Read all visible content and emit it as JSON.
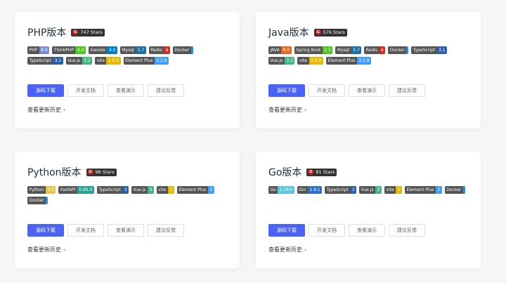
{
  "cards": [
    {
      "title": "PHP版本",
      "stars": "747 Stars",
      "badges": [
        {
          "k": "PHP",
          "v": "8.0",
          "color": "#7b8ed0"
        },
        {
          "k": "ThinkPHP",
          "v": "6.0",
          "color": "#4cc61e"
        },
        {
          "k": "Swoole",
          "v": "4.0",
          "color": "#007ec6"
        },
        {
          "k": "Mysql",
          "v": "5.7",
          "color": "#1c6ea4"
        },
        {
          "k": "Redis",
          "v": "6",
          "color": "#d9281e"
        },
        {
          "k": "Docker",
          "v": "",
          "color": "#1d8ff0"
        },
        {
          "k": "TypeScript",
          "v": "3.1",
          "color": "#2b5fa8"
        },
        {
          "k": "Vue.js",
          "v": "3.2",
          "color": "#42b883"
        },
        {
          "k": "vite",
          "v": "2.0.0",
          "color": "#e6b800"
        },
        {
          "k": "Element Plus",
          "v": "2.2.8",
          "color": "#409eff"
        }
      ],
      "buttons": [
        "源码下载",
        "开发文档",
        "查看演示",
        "建议反馈"
      ],
      "history": "查看更新历史"
    },
    {
      "title": "Java版本",
      "stars": "576 Stars",
      "badges": [
        {
          "k": "JAVA",
          "v": "8.0",
          "color": "#e56a1f"
        },
        {
          "k": "Spring Boot",
          "v": "2.5",
          "color": "#4cc61e"
        },
        {
          "k": "Mysql",
          "v": "5.7",
          "color": "#1c6ea4"
        },
        {
          "k": "Redis",
          "v": "6",
          "color": "#d9281e"
        },
        {
          "k": "Docker",
          "v": "",
          "color": "#1d8ff0"
        },
        {
          "k": "TypeScript",
          "v": "3.1",
          "color": "#2b5fa8"
        },
        {
          "k": "Vue.js",
          "v": "3.2",
          "color": "#42b883"
        },
        {
          "k": "vite",
          "v": "2.0.0",
          "color": "#e6b800"
        },
        {
          "k": "Element Plus",
          "v": "2.2.8",
          "color": "#409eff"
        }
      ],
      "buttons": [
        "源码下载",
        "开发文档",
        "查看演示",
        "建议反馈"
      ],
      "history": "查看更新历史"
    },
    {
      "title": "Python版本",
      "stars": "98 Stars",
      "badges": [
        {
          "k": "Python",
          "v": "3.5",
          "color": "#e6c34a"
        },
        {
          "k": "FastAPI",
          "v": "0.85.0",
          "color": "#2aa198"
        },
        {
          "k": "TypeScript",
          "v": "3",
          "color": "#2b5fa8"
        },
        {
          "k": "Vue.js",
          "v": "3",
          "color": "#42b883"
        },
        {
          "k": "vite",
          "v": "2",
          "color": "#e6b800"
        },
        {
          "k": "Element Plus",
          "v": "2",
          "color": "#409eff"
        },
        {
          "k": "Docker",
          "v": "",
          "color": "#1d8ff0"
        }
      ],
      "buttons": [
        "源码下载",
        "开发文档",
        "查看演示",
        "建议反馈"
      ],
      "history": "查看更新历史"
    },
    {
      "title": "Go版本",
      "stars": "81 Stars",
      "badges": [
        {
          "k": "Go",
          "v": "1.16+",
          "color": "#5cc8e0"
        },
        {
          "k": "Gin",
          "v": "1.8.1",
          "color": "#2f6cc6"
        },
        {
          "k": "TypeScript",
          "v": "3",
          "color": "#2b5fa8"
        },
        {
          "k": "Vue.js",
          "v": "3",
          "color": "#42b883"
        },
        {
          "k": "vite",
          "v": "2",
          "color": "#e6b800"
        },
        {
          "k": "Element Plus",
          "v": "2",
          "color": "#409eff"
        },
        {
          "k": "Docker",
          "v": "",
          "color": "#1d8ff0"
        }
      ],
      "buttons": [
        "源码下载",
        "开发文档",
        "查看演示",
        "建议反馈"
      ],
      "history": "查看更新历史"
    }
  ],
  "icons": {
    "stars": "gitee-icon",
    "history": "chevron-right-icon"
  }
}
